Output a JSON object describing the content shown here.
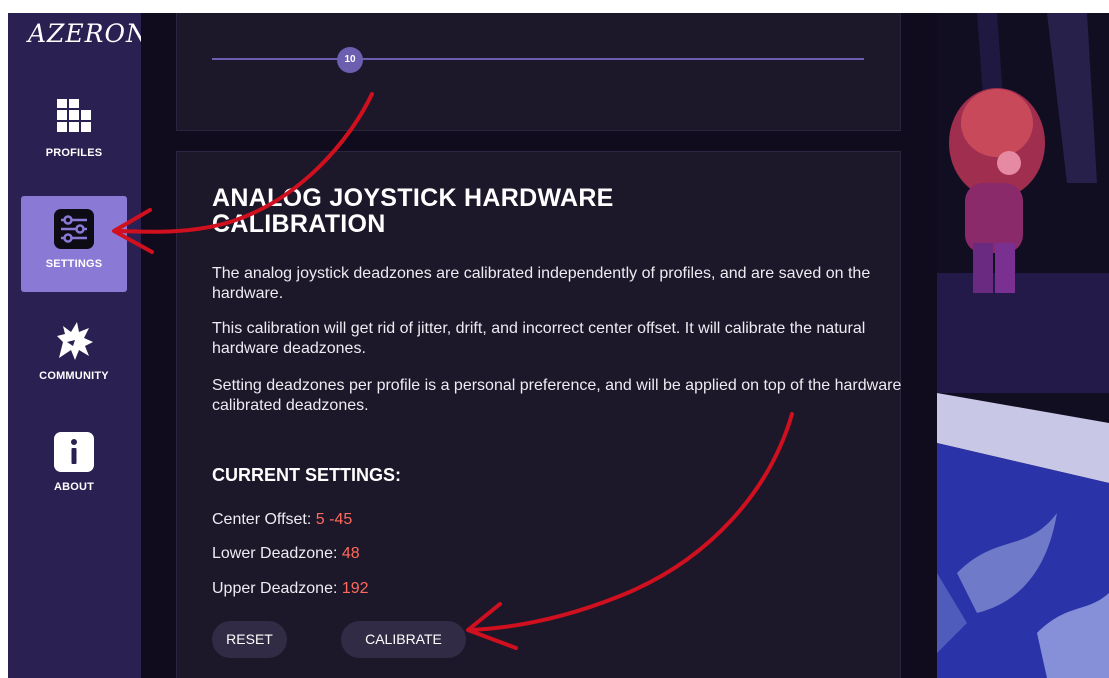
{
  "app": {
    "logo_text": "AZERON"
  },
  "sidebar": {
    "items": [
      {
        "label": "PROFILES",
        "icon": "grid-icon",
        "active": false
      },
      {
        "label": "SETTINGS",
        "icon": "sliders-icon",
        "active": true
      },
      {
        "label": "COMMUNITY",
        "icon": "dragon-icon",
        "active": false
      },
      {
        "label": "ABOUT",
        "icon": "info-icon",
        "active": false
      }
    ]
  },
  "slider": {
    "value": "10"
  },
  "calibration": {
    "title": "ANALOG JOYSTICK HARDWARE CALIBRATION",
    "paragraphs": [
      "The analog joystick deadzones are calibrated independently of profiles, and are saved on the hardware.",
      "This calibration will get rid of jitter, drift, and incorrect center offset. It will calibrate the natural hardware deadzones.",
      "Setting deadzones per profile is a personal preference, and will be applied on top of the hardware calibrated deadzones."
    ],
    "current_settings_title": "CURRENT SETTINGS:",
    "center_offset_label": "Center Offset:",
    "center_offset_value": "5 -45",
    "lower_deadzone_label": "Lower Deadzone:",
    "lower_deadzone_value": "48",
    "upper_deadzone_label": "Upper Deadzone:",
    "upper_deadzone_value": "192",
    "reset_label": "RESET",
    "calibrate_label": "CALIBRATE"
  },
  "colors": {
    "sidebar_bg": "#2a2152",
    "active_nav": "#8a7ad6",
    "accent": "#6c5fb0",
    "value_text": "#ff6a5a",
    "annotation_arrow": "#d0101e"
  }
}
